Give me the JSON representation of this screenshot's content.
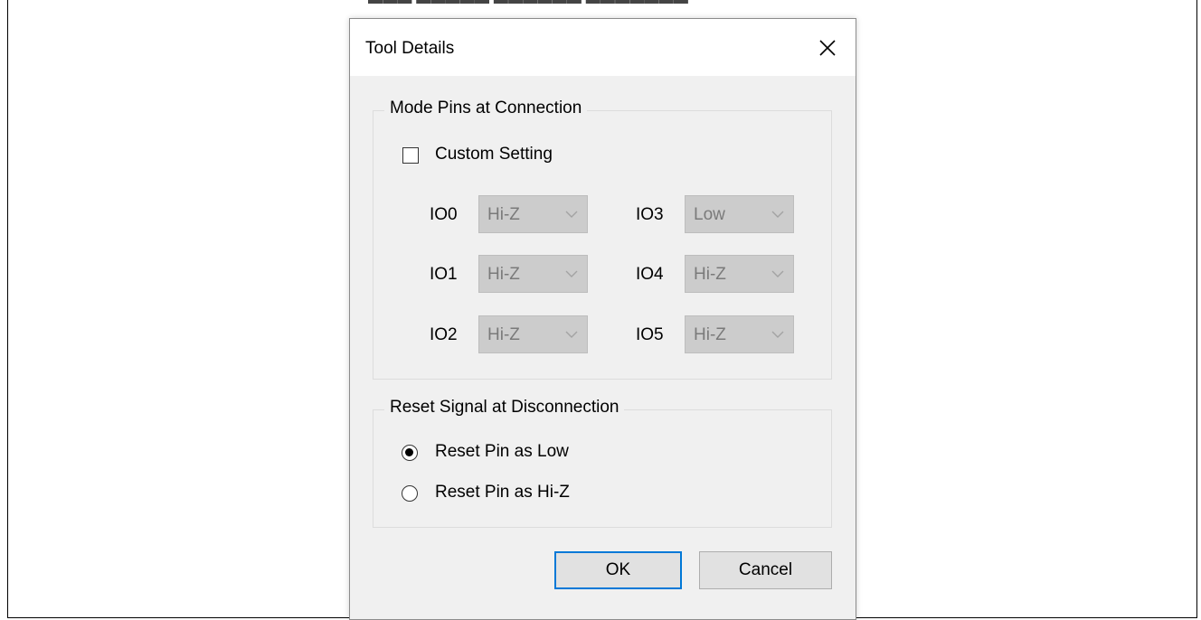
{
  "dialog": {
    "title": "Tool Details",
    "close_icon": "close-icon"
  },
  "mode_pins": {
    "group_title": "Mode Pins at Connection",
    "custom_setting": {
      "label": "Custom Setting",
      "checked": false
    },
    "pins": [
      {
        "label": "IO0",
        "value": "Hi-Z"
      },
      {
        "label": "IO1",
        "value": "Hi-Z"
      },
      {
        "label": "IO2",
        "value": "Hi-Z"
      },
      {
        "label": "IO3",
        "value": "Low"
      },
      {
        "label": "IO4",
        "value": "Hi-Z"
      },
      {
        "label": "IO5",
        "value": "Hi-Z"
      }
    ]
  },
  "reset_signal": {
    "group_title": "Reset Signal at Disconnection",
    "options": [
      {
        "label": "Reset Pin as Low",
        "selected": true
      },
      {
        "label": "Reset Pin as Hi-Z",
        "selected": false
      }
    ]
  },
  "buttons": {
    "ok_label": "OK",
    "cancel_label": "Cancel"
  },
  "colors": {
    "dialog_bg": "#f0f0f0",
    "disabled_combo_bg": "#cccccc",
    "default_button_border": "#0078d7"
  }
}
